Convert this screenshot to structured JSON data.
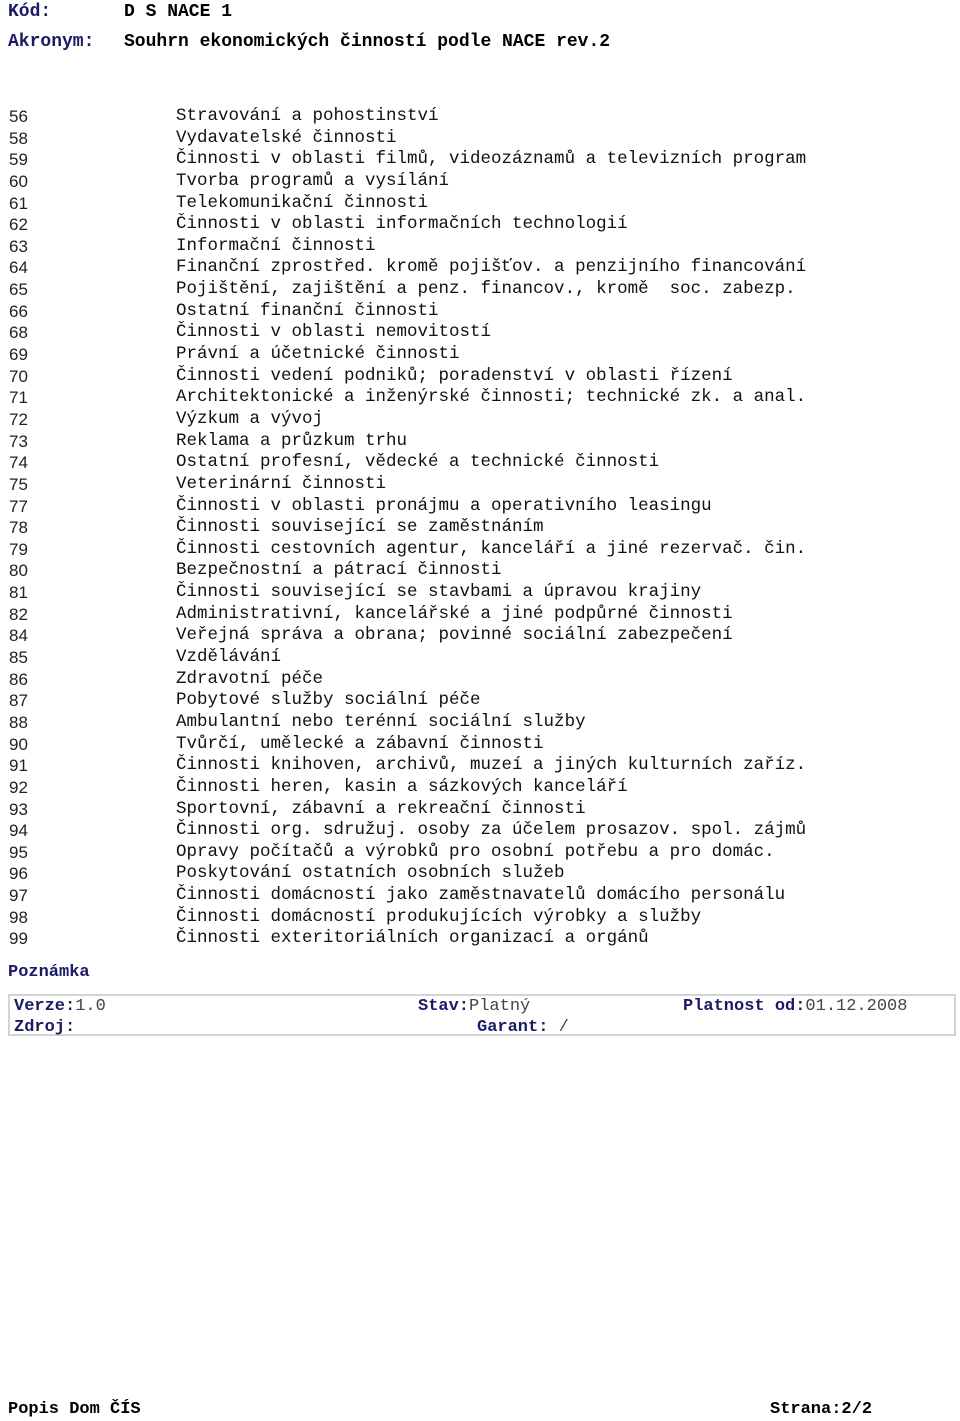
{
  "header": {
    "kod_label": "Kód:",
    "kod_value": "D S NACE 1",
    "akronym_label": "Akronym:",
    "akronym_value": "Souhrn ekonomických činností podle NACE rev.2"
  },
  "items": [
    {
      "code": "56",
      "name": "Stravování a pohostinství"
    },
    {
      "code": "58",
      "name": "Vydavatelské činnosti"
    },
    {
      "code": "59",
      "name": "Činnosti v oblasti filmů, videozáznamů a televizních program"
    },
    {
      "code": "60",
      "name": "Tvorba programů a vysílání"
    },
    {
      "code": "61",
      "name": "Telekomunikační činnosti"
    },
    {
      "code": "62",
      "name": "Činnosti v oblasti informačních technologií"
    },
    {
      "code": "63",
      "name": "Informační činnosti"
    },
    {
      "code": "64",
      "name": "Finanční zprostřed. kromě pojišťov. a penzijního financování"
    },
    {
      "code": "65",
      "name": "Pojištění, zajištění a penz. financov., kromě  soc. zabezp."
    },
    {
      "code": "66",
      "name": "Ostatní finanční činnosti"
    },
    {
      "code": "68",
      "name": "Činnosti v oblasti nemovitostí"
    },
    {
      "code": "69",
      "name": "Právní a účetnické činnosti"
    },
    {
      "code": "70",
      "name": "Činnosti vedení podniků; poradenství v oblasti řízení"
    },
    {
      "code": "71",
      "name": "Architektonické a inženýrské činnosti; technické zk. a anal."
    },
    {
      "code": "72",
      "name": "Výzkum a vývoj"
    },
    {
      "code": "73",
      "name": "Reklama a průzkum trhu"
    },
    {
      "code": "74",
      "name": "Ostatní profesní, vědecké a technické činnosti"
    },
    {
      "code": "75",
      "name": "Veterinární činnosti"
    },
    {
      "code": "77",
      "name": "Činnosti v oblasti pronájmu a operativního leasingu"
    },
    {
      "code": "78",
      "name": "Činnosti související se zaměstnáním"
    },
    {
      "code": "79",
      "name": "Činnosti cestovních agentur, kanceláří a jiné rezervač. čin."
    },
    {
      "code": "80",
      "name": "Bezpečnostní a pátrací činnosti"
    },
    {
      "code": "81",
      "name": "Činnosti související se stavbami a úpravou krajiny"
    },
    {
      "code": "82",
      "name": "Administrativní, kancelářské a jiné podpůrné činnosti"
    },
    {
      "code": "84",
      "name": "Veřejná správa a obrana; povinné sociální zabezpečení"
    },
    {
      "code": "85",
      "name": "Vzdělávání"
    },
    {
      "code": "86",
      "name": "Zdravotní péče"
    },
    {
      "code": "87",
      "name": "Pobytové služby sociální péče"
    },
    {
      "code": "88",
      "name": "Ambulantní nebo terénní sociální služby"
    },
    {
      "code": "90",
      "name": "Tvůrčí, umělecké a zábavní činnosti"
    },
    {
      "code": "91",
      "name": "Činnosti knihoven, archivů, muzeí a jiných kulturních zaříz."
    },
    {
      "code": "92",
      "name": "Činnosti heren, kasin a sázkových kanceláří"
    },
    {
      "code": "93",
      "name": "Sportovní, zábavní a rekreační činnosti"
    },
    {
      "code": "94",
      "name": "Činnosti org. sdružuj. osoby za účelem prosazov. spol. zájmů"
    },
    {
      "code": "95",
      "name": "Opravy počítačů a výrobků pro osobní potřebu a pro domác."
    },
    {
      "code": "96",
      "name": "Poskytování ostatních osobních služeb"
    },
    {
      "code": "97",
      "name": "Činnosti domácností jako zaměstnavatelů domácího personálu"
    },
    {
      "code": "98",
      "name": "Činnosti domácností produkujících výrobky a služby"
    },
    {
      "code": "99",
      "name": "Činnosti exteritoriálních organizací a orgánů"
    }
  ],
  "note": {
    "title": "Poznámka"
  },
  "meta": {
    "verze_label": "Verze:",
    "verze_value": "1.0",
    "zdroj_label": "Zdroj:",
    "zdroj_value": "",
    "stav_label": "Stav:",
    "stav_value": "Platný",
    "garant_label": "Garant:",
    "garant_value": " /",
    "platnost_label": "Platnost od:",
    "platnost_value": "01.12.2008"
  },
  "footer": {
    "left": "Popis Dom ČÍS",
    "right": "Strana:2/2"
  },
  "colors": {
    "label": "#1a1a66",
    "box_border": "#d4d4d4"
  }
}
